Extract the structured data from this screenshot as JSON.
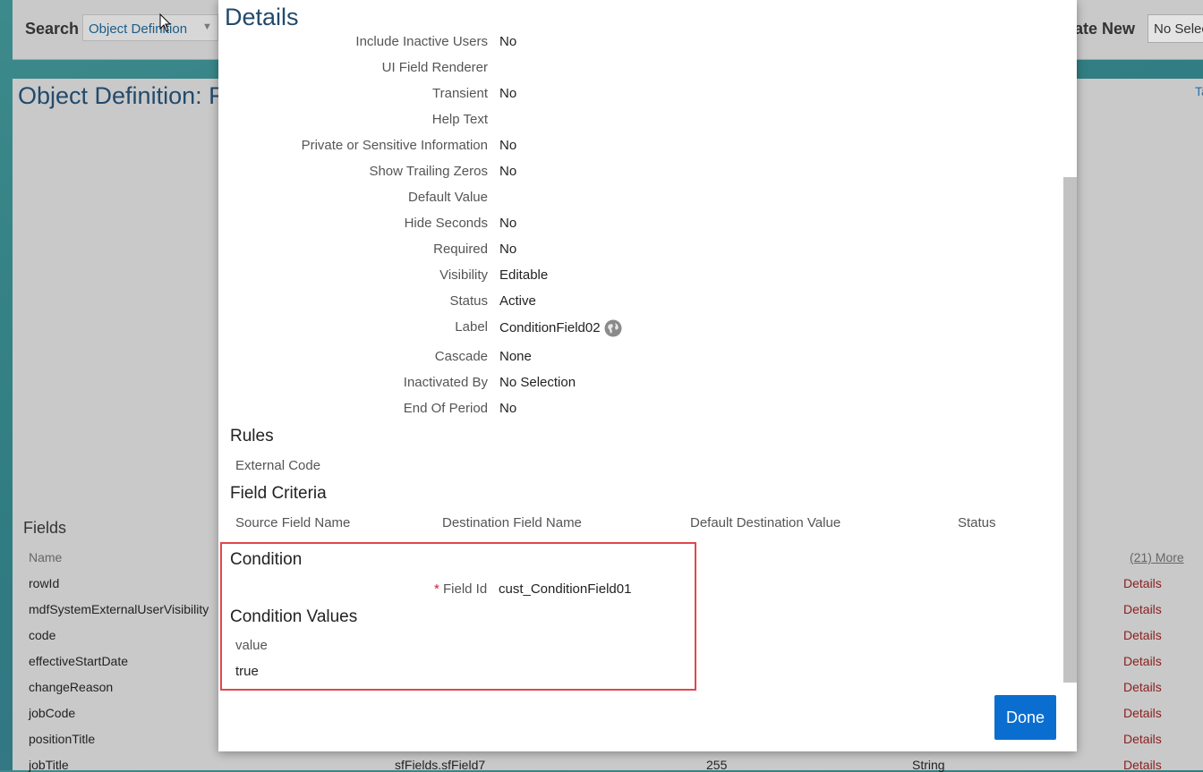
{
  "app": {
    "search_label": "Search",
    "search_value": "Object Definition",
    "create_new_label": "eate New",
    "create_new_value": "No Selec"
  },
  "background": {
    "object_title": "Object Definition: F",
    "top_right_link": "Ta",
    "fields_heading": "Fields",
    "fields_column_name": "Name",
    "more_link": "(21) More",
    "details_label": "Details",
    "field_rows": [
      "rowId",
      "mdfSystemExternalUserVisibility",
      "code",
      "effectiveStartDate",
      "changeReason",
      "jobCode",
      "positionTitle",
      "jobTitle"
    ],
    "last_row_cells": [
      "sfFields.sfField7",
      "255",
      "String"
    ]
  },
  "modal": {
    "title": "Details",
    "properties": [
      {
        "label": "Include Inactive Users",
        "value": "No"
      },
      {
        "label": "UI Field Renderer",
        "value": ""
      },
      {
        "label": "Transient",
        "value": "No"
      },
      {
        "label": "Help Text",
        "value": ""
      },
      {
        "label": "Private or Sensitive Information",
        "value": "No"
      },
      {
        "label": "Show Trailing Zeros",
        "value": "No"
      },
      {
        "label": "Default Value",
        "value": ""
      },
      {
        "label": "Hide Seconds",
        "value": "No"
      },
      {
        "label": "Required",
        "value": "No"
      },
      {
        "label": "Visibility",
        "value": "Editable"
      },
      {
        "label": "Status",
        "value": "Active"
      },
      {
        "label": "Label",
        "value": "ConditionField02",
        "icon": "globe-icon"
      },
      {
        "label": "Cascade",
        "value": "None"
      },
      {
        "label": "Inactivated By",
        "value": "No Selection"
      },
      {
        "label": "End Of Period",
        "value": "No"
      }
    ],
    "rules": {
      "title": "Rules",
      "column": "External Code"
    },
    "field_criteria": {
      "title": "Field Criteria",
      "columns": [
        "Source Field Name",
        "Destination Field Name",
        "Default Destination Value",
        "Status"
      ]
    },
    "condition": {
      "title": "Condition",
      "required_marker": "*",
      "field_id_label": "Field Id",
      "field_id_value": "cust_ConditionField01"
    },
    "condition_values": {
      "title": "Condition Values",
      "column": "value",
      "rows": [
        "true"
      ]
    },
    "done_label": "Done",
    "highlight_color": "#e0474c",
    "button_color": "#0a6ed1"
  }
}
